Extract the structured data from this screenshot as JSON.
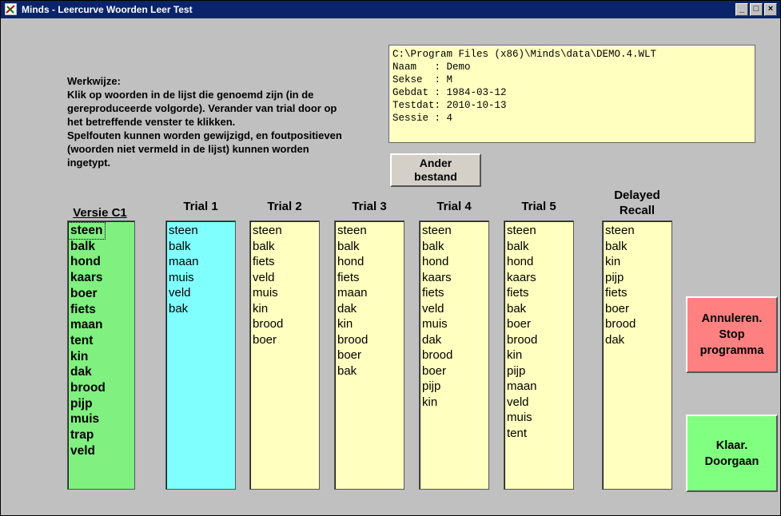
{
  "window": {
    "title": "Minds - Leercurve Woorden Leer Test"
  },
  "controls": {
    "minimize": "_",
    "restore": "□",
    "close": "×"
  },
  "instructions": [
    "Werkwijze:",
    "Klik op woorden in de lijst die genoemd zijn (in de",
    "gereproduceerde volgorde). Verander van trial door op",
    "het betreffende venster te klikken.",
    "Spelfouten kunnen worden gewijzigd, en foutpositieven",
    "(woorden niet vermeld in de lijst) kunnen worden",
    "ingetypt."
  ],
  "info": {
    "path": "C:\\Program Files (x86)\\Minds\\data\\DEMO.4.WLT",
    "naam": "Naam   : Demo",
    "sekse": "Sekse  : M",
    "gebdat": "Gebdat : 1984-03-12",
    "testdat": "Testdat: 2010-10-13",
    "sessie": "Sessie : 4"
  },
  "buttons": {
    "other_file": [
      "Ander",
      "bestand"
    ],
    "cancel": [
      "Annuleren.",
      "Stop",
      "programma"
    ],
    "ok": [
      "Klaar.",
      "Doorgaan"
    ]
  },
  "columns": {
    "versie": {
      "label": "Versie C1",
      "words": [
        "steen",
        "balk",
        "hond",
        "kaars",
        "boer",
        "fiets",
        "maan",
        "tent",
        "kin",
        "dak",
        "brood",
        "pijp",
        "muis",
        "trap",
        "veld"
      ]
    },
    "trial1": {
      "label": "Trial 1",
      "words": [
        "steen",
        "balk",
        "maan",
        "muis",
        "veld",
        "bak"
      ]
    },
    "trial2": {
      "label": "Trial 2",
      "words": [
        "steen",
        "balk",
        "fiets",
        "veld",
        "muis",
        "kin",
        "brood",
        "boer"
      ]
    },
    "trial3": {
      "label": "Trial 3",
      "words": [
        "steen",
        "balk",
        "hond",
        "fiets",
        "maan",
        "dak",
        "kin",
        "brood",
        "boer",
        "bak"
      ]
    },
    "trial4": {
      "label": "Trial 4",
      "words": [
        "steen",
        "balk",
        "hond",
        "kaars",
        "fiets",
        "veld",
        "muis",
        "dak",
        "brood",
        "boer",
        "pijp",
        "kin"
      ]
    },
    "trial5": {
      "label": "Trial 5",
      "words": [
        "steen",
        "balk",
        "hond",
        "kaars",
        "fiets",
        "bak",
        "boer",
        "brood",
        "kin",
        "pijp",
        "maan",
        "veld",
        "muis",
        "tent"
      ]
    },
    "delayed": {
      "label": [
        "Delayed",
        "Recall"
      ],
      "words": [
        "steen",
        "balk",
        "kin",
        "pijp",
        "fiets",
        "boer",
        "brood",
        "dak"
      ]
    }
  }
}
